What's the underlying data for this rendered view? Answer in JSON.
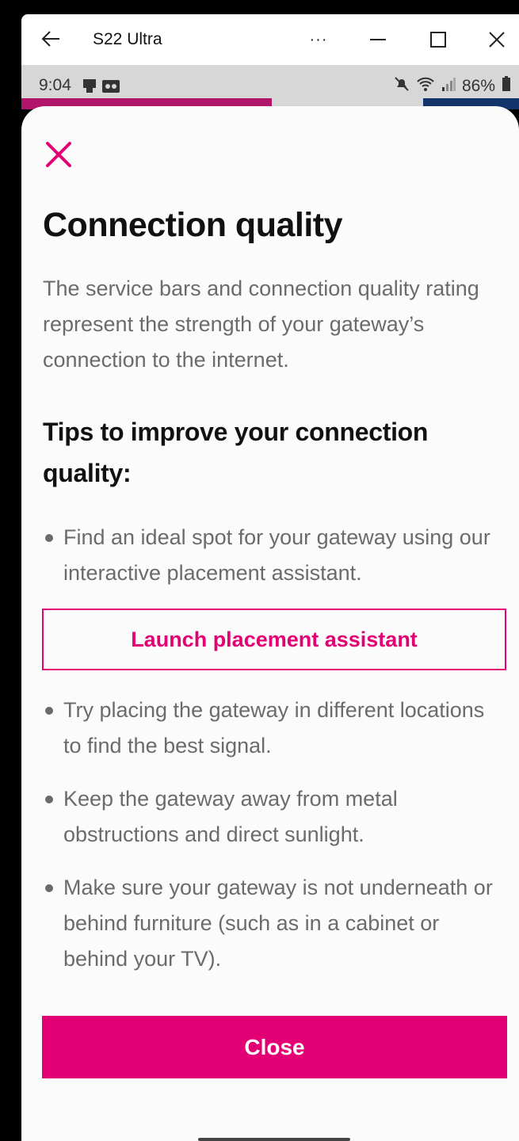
{
  "window": {
    "title": "S22 Ultra",
    "more_label": "···"
  },
  "status_bar": {
    "time": "9:04",
    "battery": "86%"
  },
  "sheet": {
    "heading": "Connection quality",
    "description": "The service bars and connection quality rating represent the strength of your gateway’s connection to the internet.",
    "tips_heading": "Tips to improve your connection quality:",
    "tips": [
      "Find an ideal spot for your gateway using our interactive placement assistant.",
      "Try placing the gateway in different locations to find the best signal.",
      "Keep the gateway away from metal obstructions and direct sunlight.",
      "Make sure your gateway is not underneath or behind furniture (such as in a cabinet or behind your TV)."
    ],
    "launch_button_label": "Launch placement assistant",
    "close_button_label": "Close"
  },
  "colors": {
    "brand_magenta": "#e20074",
    "text_dark": "#111111",
    "text_gray": "#6b6b6b"
  }
}
